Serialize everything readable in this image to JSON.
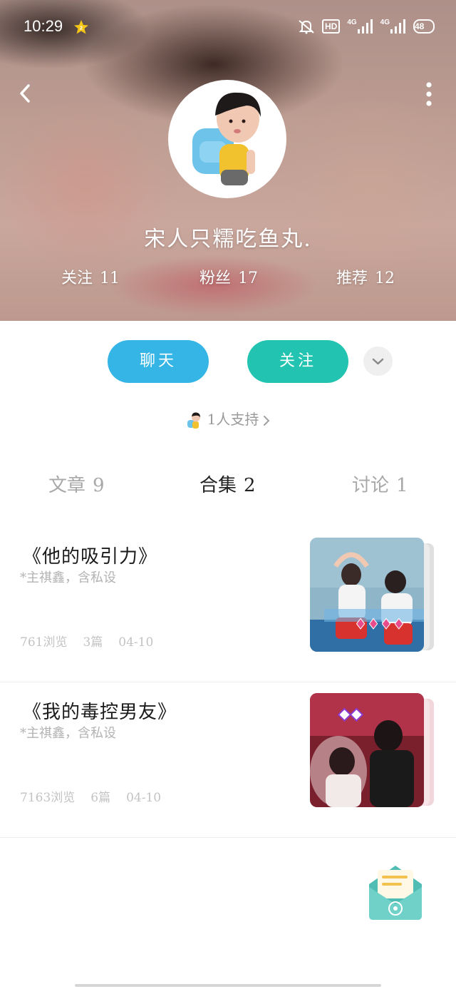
{
  "status_bar": {
    "time": "10:29",
    "hd_label": "HD",
    "net1": "4G",
    "net2": "4G",
    "battery": "48"
  },
  "profile": {
    "nickname": "宋人只糯吃鱼丸.",
    "stats": {
      "following_label": "关注",
      "following_count": "11",
      "fans_label": "粉丝",
      "fans_count": "17",
      "recommend_label": "推荐",
      "recommend_count": "12"
    }
  },
  "actions": {
    "chat_label": "聊天",
    "follow_label": "关注"
  },
  "support": {
    "text": "1人支持"
  },
  "tabs": [
    {
      "label": "文章",
      "count": "9",
      "active": false
    },
    {
      "label": "合集",
      "count": "2",
      "active": true
    },
    {
      "label": "讨论",
      "count": "1",
      "active": false
    }
  ],
  "collections": [
    {
      "title": "《他的吸引力》",
      "desc": "*主祺鑫，含私设",
      "views": "761浏览",
      "chapters": "3篇",
      "date": "04-10"
    },
    {
      "title": "《我的毒控男友》",
      "desc": "*主祺鑫，含私设",
      "views": "7163浏览",
      "chapters": "6篇",
      "date": "04-10"
    }
  ],
  "colors": {
    "chat_button": "#34b5e6",
    "follow_button": "#22c4b1",
    "mail_fab": "#5cc9c0"
  }
}
